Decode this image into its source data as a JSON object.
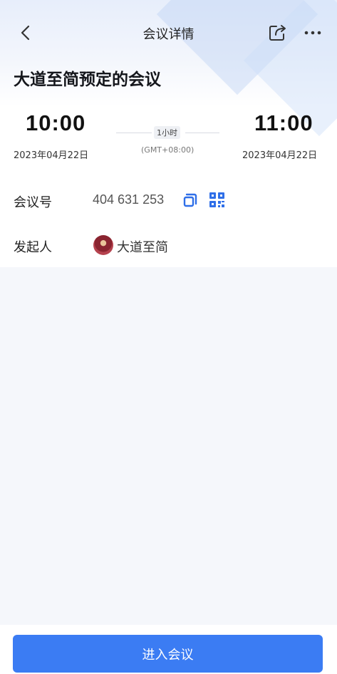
{
  "nav": {
    "title": "会议详情",
    "icons": {
      "back": "chevron-left-icon",
      "share": "share-icon",
      "more": "more-icon"
    }
  },
  "meeting": {
    "title": "大道至简预定的会议",
    "start_time": "10:00",
    "start_date": "2023年04月22日",
    "end_time": "11:00",
    "end_date": "2023年04月22日",
    "duration": "1小时",
    "timezone": "(GMT+08:00)"
  },
  "details": {
    "meeting_id_label": "会议号",
    "meeting_id": "404 631 253",
    "organizer_label": "发起人",
    "organizer_name": "大道至简"
  },
  "actions": {
    "join_label": "进入会议"
  },
  "colors": {
    "accent": "#3b7cf3",
    "icon_blue": "#2f6fe8",
    "background": "#f5f7fb"
  }
}
